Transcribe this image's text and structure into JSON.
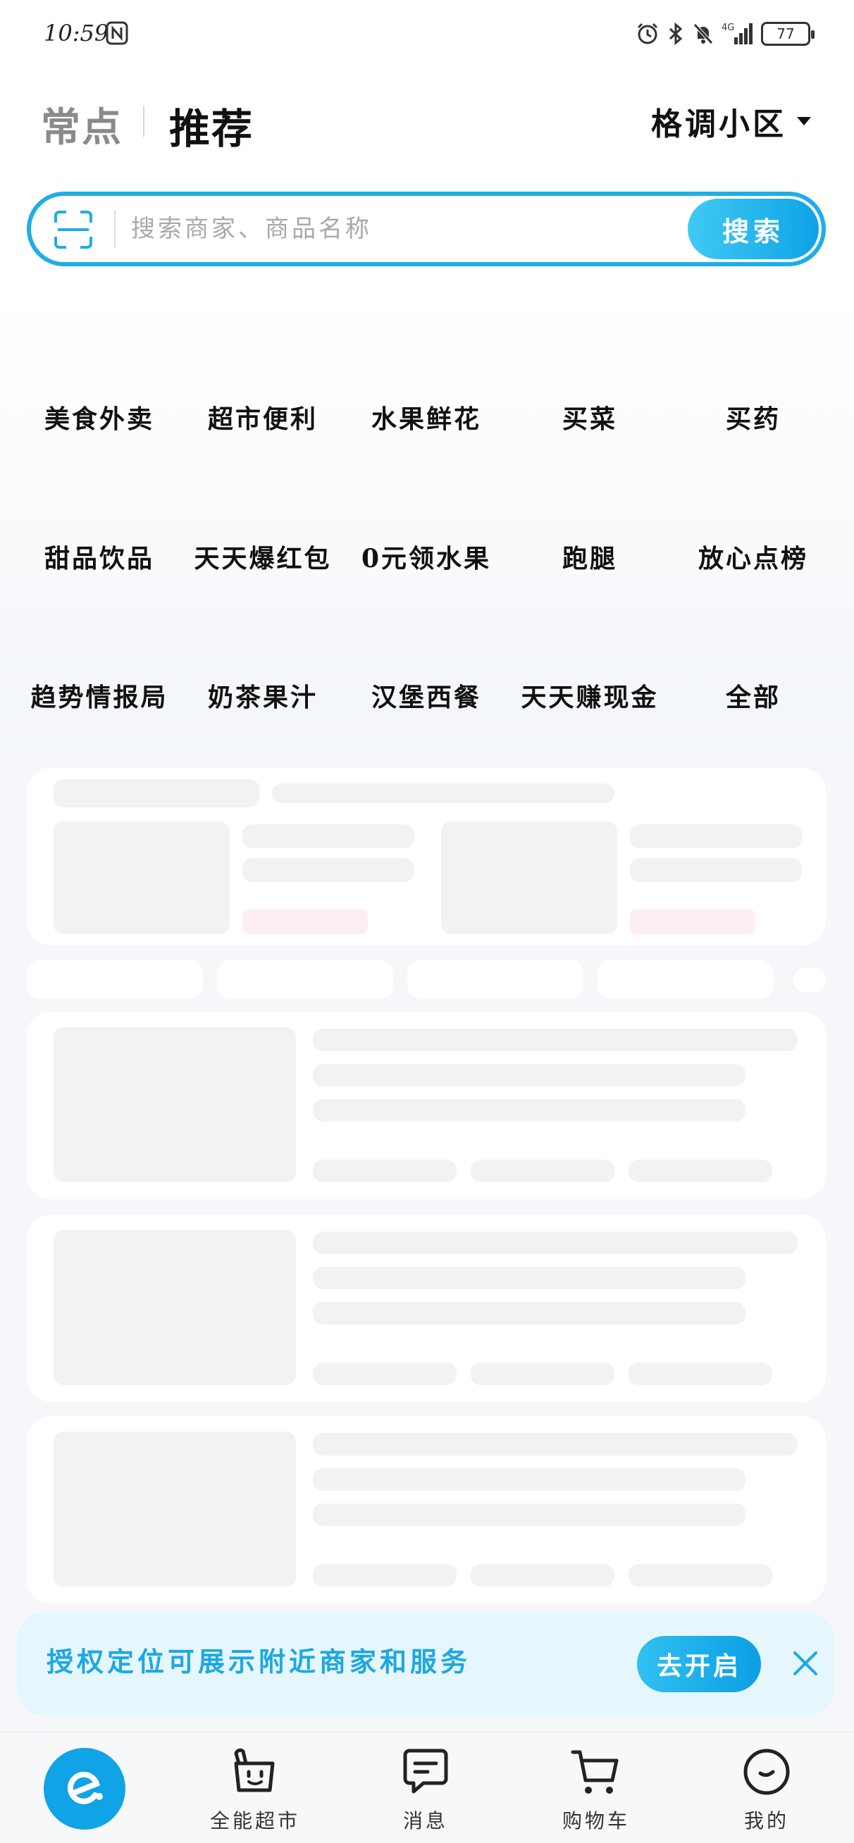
{
  "status_bar": {
    "time": "10:59",
    "network": "4G",
    "battery": "77"
  },
  "header": {
    "tab_frequent": "常点",
    "tab_recommend": "推荐",
    "location": "格调小区"
  },
  "search": {
    "placeholder": "搜索商家、商品名称",
    "button_label": "搜索"
  },
  "categories": {
    "row1": [
      "美食外卖",
      "超市便利",
      "水果鲜花",
      "买菜",
      "买药"
    ],
    "row2": [
      "甜品饮品",
      "天天爆红包",
      "0元领水果",
      "跑腿",
      "放心点榜"
    ],
    "row3": [
      "趋势情报局",
      "奶茶果汁",
      "汉堡西餐",
      "天天赚现金",
      "全部"
    ]
  },
  "location_banner": {
    "text": "授权定位可展示附近商家和服务",
    "button_label": "去开启"
  },
  "bottom_nav": {
    "items": [
      {
        "label": "",
        "icon": "eleme-home-icon"
      },
      {
        "label": "全能超市",
        "icon": "shopping-bag-icon"
      },
      {
        "label": "消息",
        "icon": "message-icon"
      },
      {
        "label": "购物车",
        "icon": "cart-icon"
      },
      {
        "label": "我的",
        "icon": "profile-icon"
      }
    ]
  },
  "colors": {
    "accent": "#1daee6",
    "banner_bg": "#e6f6fd",
    "skeleton": "#f1f2f4"
  }
}
